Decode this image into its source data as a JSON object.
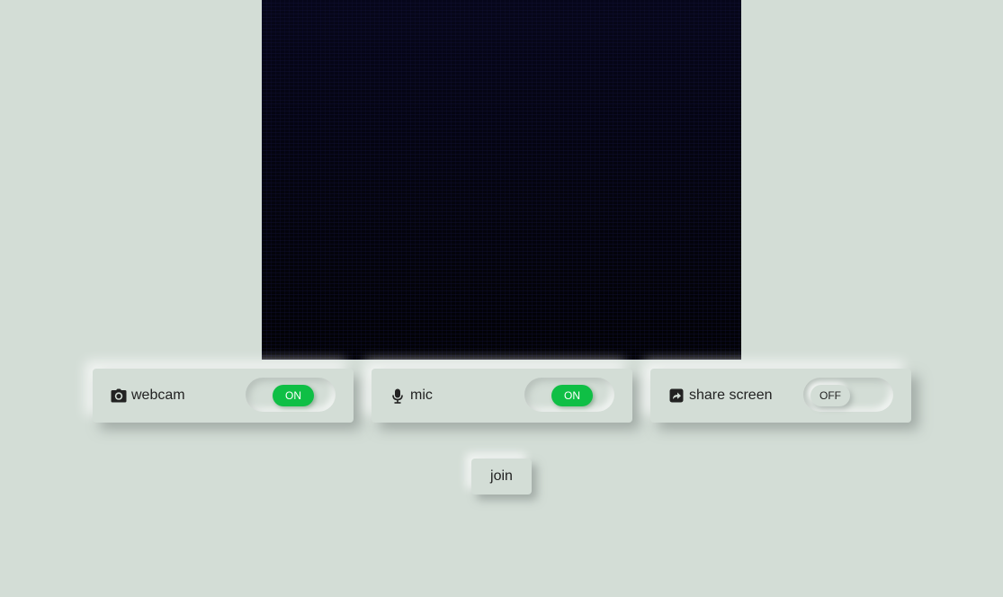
{
  "controls": {
    "webcam": {
      "icon": "camera-icon",
      "label": "webcam",
      "state": "ON"
    },
    "mic": {
      "icon": "microphone-icon",
      "label": "mic",
      "state": "ON"
    },
    "share_screen": {
      "icon": "share-icon",
      "label": "share screen",
      "state": "OFF"
    }
  },
  "join_button": {
    "label": "join"
  },
  "colors": {
    "background": "#d3ddd6",
    "toggle_on": "#0fbf45",
    "video_bg": "#04040f"
  }
}
